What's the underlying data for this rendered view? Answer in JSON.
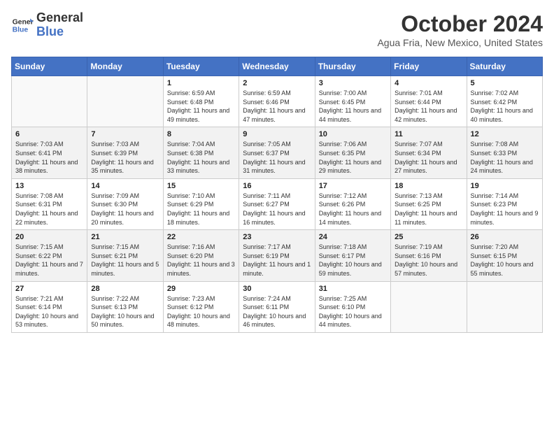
{
  "header": {
    "logo_line1": "General",
    "logo_line2": "Blue",
    "month_title": "October 2024",
    "location": "Agua Fria, New Mexico, United States"
  },
  "weekdays": [
    "Sunday",
    "Monday",
    "Tuesday",
    "Wednesday",
    "Thursday",
    "Friday",
    "Saturday"
  ],
  "weeks": [
    [
      {
        "day": "",
        "info": ""
      },
      {
        "day": "",
        "info": ""
      },
      {
        "day": "1",
        "info": "Sunrise: 6:59 AM\nSunset: 6:48 PM\nDaylight: 11 hours and 49 minutes."
      },
      {
        "day": "2",
        "info": "Sunrise: 6:59 AM\nSunset: 6:46 PM\nDaylight: 11 hours and 47 minutes."
      },
      {
        "day": "3",
        "info": "Sunrise: 7:00 AM\nSunset: 6:45 PM\nDaylight: 11 hours and 44 minutes."
      },
      {
        "day": "4",
        "info": "Sunrise: 7:01 AM\nSunset: 6:44 PM\nDaylight: 11 hours and 42 minutes."
      },
      {
        "day": "5",
        "info": "Sunrise: 7:02 AM\nSunset: 6:42 PM\nDaylight: 11 hours and 40 minutes."
      }
    ],
    [
      {
        "day": "6",
        "info": "Sunrise: 7:03 AM\nSunset: 6:41 PM\nDaylight: 11 hours and 38 minutes."
      },
      {
        "day": "7",
        "info": "Sunrise: 7:03 AM\nSunset: 6:39 PM\nDaylight: 11 hours and 35 minutes."
      },
      {
        "day": "8",
        "info": "Sunrise: 7:04 AM\nSunset: 6:38 PM\nDaylight: 11 hours and 33 minutes."
      },
      {
        "day": "9",
        "info": "Sunrise: 7:05 AM\nSunset: 6:37 PM\nDaylight: 11 hours and 31 minutes."
      },
      {
        "day": "10",
        "info": "Sunrise: 7:06 AM\nSunset: 6:35 PM\nDaylight: 11 hours and 29 minutes."
      },
      {
        "day": "11",
        "info": "Sunrise: 7:07 AM\nSunset: 6:34 PM\nDaylight: 11 hours and 27 minutes."
      },
      {
        "day": "12",
        "info": "Sunrise: 7:08 AM\nSunset: 6:33 PM\nDaylight: 11 hours and 24 minutes."
      }
    ],
    [
      {
        "day": "13",
        "info": "Sunrise: 7:08 AM\nSunset: 6:31 PM\nDaylight: 11 hours and 22 minutes."
      },
      {
        "day": "14",
        "info": "Sunrise: 7:09 AM\nSunset: 6:30 PM\nDaylight: 11 hours and 20 minutes."
      },
      {
        "day": "15",
        "info": "Sunrise: 7:10 AM\nSunset: 6:29 PM\nDaylight: 11 hours and 18 minutes."
      },
      {
        "day": "16",
        "info": "Sunrise: 7:11 AM\nSunset: 6:27 PM\nDaylight: 11 hours and 16 minutes."
      },
      {
        "day": "17",
        "info": "Sunrise: 7:12 AM\nSunset: 6:26 PM\nDaylight: 11 hours and 14 minutes."
      },
      {
        "day": "18",
        "info": "Sunrise: 7:13 AM\nSunset: 6:25 PM\nDaylight: 11 hours and 11 minutes."
      },
      {
        "day": "19",
        "info": "Sunrise: 7:14 AM\nSunset: 6:23 PM\nDaylight: 11 hours and 9 minutes."
      }
    ],
    [
      {
        "day": "20",
        "info": "Sunrise: 7:15 AM\nSunset: 6:22 PM\nDaylight: 11 hours and 7 minutes."
      },
      {
        "day": "21",
        "info": "Sunrise: 7:15 AM\nSunset: 6:21 PM\nDaylight: 11 hours and 5 minutes."
      },
      {
        "day": "22",
        "info": "Sunrise: 7:16 AM\nSunset: 6:20 PM\nDaylight: 11 hours and 3 minutes."
      },
      {
        "day": "23",
        "info": "Sunrise: 7:17 AM\nSunset: 6:19 PM\nDaylight: 11 hours and 1 minute."
      },
      {
        "day": "24",
        "info": "Sunrise: 7:18 AM\nSunset: 6:17 PM\nDaylight: 10 hours and 59 minutes."
      },
      {
        "day": "25",
        "info": "Sunrise: 7:19 AM\nSunset: 6:16 PM\nDaylight: 10 hours and 57 minutes."
      },
      {
        "day": "26",
        "info": "Sunrise: 7:20 AM\nSunset: 6:15 PM\nDaylight: 10 hours and 55 minutes."
      }
    ],
    [
      {
        "day": "27",
        "info": "Sunrise: 7:21 AM\nSunset: 6:14 PM\nDaylight: 10 hours and 53 minutes."
      },
      {
        "day": "28",
        "info": "Sunrise: 7:22 AM\nSunset: 6:13 PM\nDaylight: 10 hours and 50 minutes."
      },
      {
        "day": "29",
        "info": "Sunrise: 7:23 AM\nSunset: 6:12 PM\nDaylight: 10 hours and 48 minutes."
      },
      {
        "day": "30",
        "info": "Sunrise: 7:24 AM\nSunset: 6:11 PM\nDaylight: 10 hours and 46 minutes."
      },
      {
        "day": "31",
        "info": "Sunrise: 7:25 AM\nSunset: 6:10 PM\nDaylight: 10 hours and 44 minutes."
      },
      {
        "day": "",
        "info": ""
      },
      {
        "day": "",
        "info": ""
      }
    ]
  ]
}
